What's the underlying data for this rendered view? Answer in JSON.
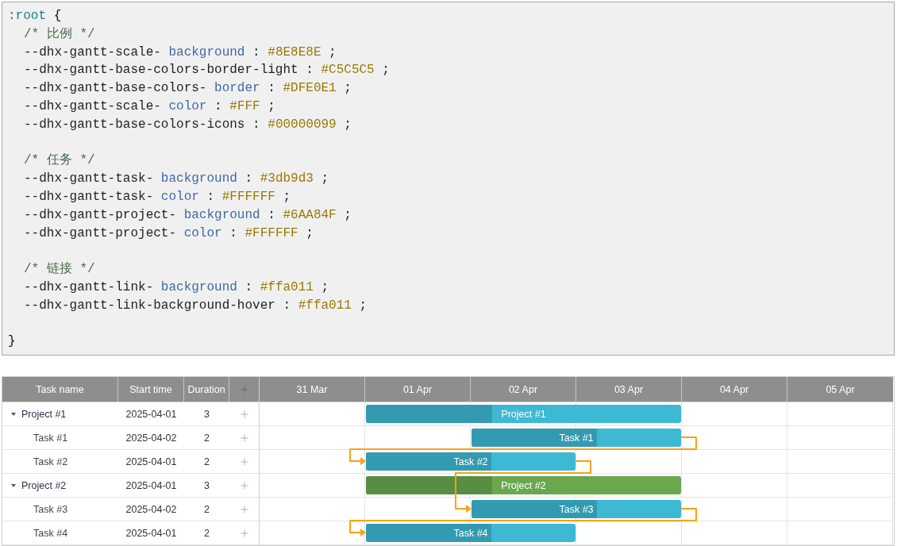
{
  "code_block": {
    "selector": ":root",
    "open": "{",
    "close": "}",
    "lines": [
      {
        "kind": "code",
        "tokens": [
          {
            "kind": "comment",
            "text": "/* 比例 */"
          }
        ]
      },
      {
        "kind": "code",
        "tokens": [
          {
            "kind": "property",
            "text": "--dhx-gantt-scale-"
          },
          {
            "kind": "keyword",
            "text": "background"
          },
          {
            "kind": "punct",
            "text": ":"
          },
          {
            "kind": "value",
            "text": "#8E8E8E"
          },
          {
            "kind": "punct",
            "text": ";"
          }
        ]
      },
      {
        "kind": "code",
        "tokens": [
          {
            "kind": "property",
            "text": "--dhx-gantt-base-colors-border-light"
          },
          {
            "kind": "punct",
            "text": ":"
          },
          {
            "kind": "value",
            "text": "#C5C5C5"
          },
          {
            "kind": "punct",
            "text": ";"
          }
        ]
      },
      {
        "kind": "code",
        "tokens": [
          {
            "kind": "property",
            "text": "--dhx-gantt-base-colors-"
          },
          {
            "kind": "keyword",
            "text": "border"
          },
          {
            "kind": "punct",
            "text": ":"
          },
          {
            "kind": "value",
            "text": "#DFE0E1"
          },
          {
            "kind": "punct",
            "text": ";"
          }
        ]
      },
      {
        "kind": "code",
        "tokens": [
          {
            "kind": "property",
            "text": "--dhx-gantt-scale-"
          },
          {
            "kind": "keyword",
            "text": "color"
          },
          {
            "kind": "punct",
            "text": ":"
          },
          {
            "kind": "value",
            "text": "#FFF"
          },
          {
            "kind": "punct",
            "text": ";"
          }
        ]
      },
      {
        "kind": "code",
        "tokens": [
          {
            "kind": "property",
            "text": "--dhx-gantt-base-colors-icons"
          },
          {
            "kind": "punct",
            "text": ":"
          },
          {
            "kind": "value",
            "text": "#00000099"
          },
          {
            "kind": "punct",
            "text": ";"
          }
        ]
      },
      {
        "kind": "blank"
      },
      {
        "kind": "code",
        "tokens": [
          {
            "kind": "comment",
            "text": "/* 任务 */"
          }
        ]
      },
      {
        "kind": "code",
        "tokens": [
          {
            "kind": "property",
            "text": "--dhx-gantt-task-"
          },
          {
            "kind": "keyword",
            "text": "background"
          },
          {
            "kind": "punct",
            "text": ":"
          },
          {
            "kind": "value",
            "text": "#3db9d3"
          },
          {
            "kind": "punct",
            "text": ";"
          }
        ]
      },
      {
        "kind": "code",
        "tokens": [
          {
            "kind": "property",
            "text": "--dhx-gantt-task-"
          },
          {
            "kind": "keyword",
            "text": "color"
          },
          {
            "kind": "punct",
            "text": ":"
          },
          {
            "kind": "value",
            "text": "#FFFFFF"
          },
          {
            "kind": "punct",
            "text": ";"
          }
        ]
      },
      {
        "kind": "code",
        "tokens": [
          {
            "kind": "property",
            "text": "--dhx-gantt-project-"
          },
          {
            "kind": "keyword",
            "text": "background"
          },
          {
            "kind": "punct",
            "text": ":"
          },
          {
            "kind": "value",
            "text": "#6AA84F"
          },
          {
            "kind": "punct",
            "text": ";"
          }
        ]
      },
      {
        "kind": "code",
        "tokens": [
          {
            "kind": "property",
            "text": "--dhx-gantt-project-"
          },
          {
            "kind": "keyword",
            "text": "color"
          },
          {
            "kind": "punct",
            "text": ":"
          },
          {
            "kind": "value",
            "text": "#FFFFFF"
          },
          {
            "kind": "punct",
            "text": ";"
          }
        ]
      },
      {
        "kind": "blank"
      },
      {
        "kind": "code",
        "tokens": [
          {
            "kind": "comment",
            "text": "/* 链接 */"
          }
        ]
      },
      {
        "kind": "code",
        "tokens": [
          {
            "kind": "property",
            "text": "--dhx-gantt-link-"
          },
          {
            "kind": "keyword",
            "text": "background"
          },
          {
            "kind": "punct",
            "text": ":"
          },
          {
            "kind": "value",
            "text": "#ffa011"
          },
          {
            "kind": "punct",
            "text": ";"
          }
        ]
      },
      {
        "kind": "code",
        "tokens": [
          {
            "kind": "property",
            "text": "--dhx-gantt-link-background-hover"
          },
          {
            "kind": "punct",
            "text": ":"
          },
          {
            "kind": "value",
            "text": "#ffa011"
          },
          {
            "kind": "punct",
            "text": ";"
          }
        ]
      },
      {
        "kind": "blank"
      }
    ]
  },
  "gantt": {
    "columns": [
      "Task name",
      "Start time",
      "Duration"
    ],
    "scale": [
      "31 Mar",
      "01 Apr",
      "02 Apr",
      "03 Apr",
      "04 Apr",
      "05 Apr"
    ],
    "rows": [
      {
        "kind": "project",
        "name": "Project #1",
        "bar_label": "Project #1",
        "color": "#3db9d3",
        "start": "2025-04-01",
        "duration": "3",
        "expanded": true,
        "level": 0.4,
        "children": [
          {
            "kind": "task",
            "name": "Task #1",
            "bar_label": "Task #1",
            "start": "2025-04-02",
            "duration": "2",
            "level": 0.6,
            "has_successor": true
          },
          {
            "kind": "task",
            "name": "Task #2",
            "bar_label": "Task #2",
            "start": "2025-04-01",
            "duration": "2",
            "level": 0.6,
            "has_successor": true
          }
        ]
      },
      {
        "kind": "project",
        "name": "Project #2",
        "bar_label": "Project #2",
        "color": "#6aa84f",
        "start": "2025-04-01",
        "duration": "3",
        "expanded": true,
        "level": 0.4,
        "children": [
          {
            "kind": "task",
            "name": "Task #3",
            "bar_label": "Task #3",
            "start": "2025-04-02",
            "duration": "2",
            "level": 0.6,
            "has_successor": true
          },
          {
            "kind": "task",
            "name": "Task #4",
            "bar_label": "Task #4",
            "start": "2025-04-01",
            "duration": "2",
            "level": 0.6
          }
        ]
      }
    ]
  }
}
